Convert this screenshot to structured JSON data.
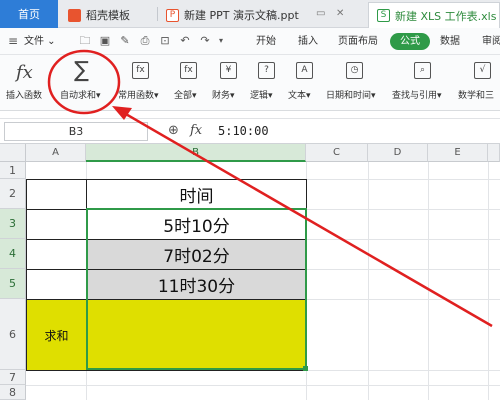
{
  "tabs": [
    {
      "label": "首页"
    },
    {
      "label": "稻壳模板"
    },
    {
      "label": "新建 PPT 演示文稿.ppt"
    },
    {
      "label": "新建 XLS 工作表.xls"
    }
  ],
  "menu": {
    "file": "文件",
    "items": [
      "开始",
      "插入",
      "页面布局",
      "公式",
      "数据",
      "审阅"
    ],
    "active": "公式"
  },
  "ribbon": [
    {
      "label": "插入函数",
      "icon": "fx-icon"
    },
    {
      "label": "自动求和",
      "icon": "sigma-icon"
    },
    {
      "label": "常用函数",
      "icon": "common-func-icon"
    },
    {
      "label": "全部",
      "icon": "all-func-icon"
    },
    {
      "label": "财务",
      "icon": "finance-icon"
    },
    {
      "label": "逻辑",
      "icon": "logic-icon"
    },
    {
      "label": "文本",
      "icon": "text-icon"
    },
    {
      "label": "日期和时间",
      "icon": "clock-icon"
    },
    {
      "label": "查找与引用",
      "icon": "lookup-icon"
    },
    {
      "label": "数学和三",
      "icon": "math-icon"
    }
  ],
  "formula_bar": {
    "cell_ref": "B3",
    "fx_label": "fx",
    "value": "5:10:00"
  },
  "sheet": {
    "columns": [
      "A",
      "B",
      "C",
      "D",
      "E"
    ],
    "rows": [
      "1",
      "2",
      "3",
      "4",
      "5",
      "6",
      "7",
      "8"
    ],
    "cells": {
      "B2": "时间",
      "B3": "5时10分",
      "B4": "7时02分",
      "B5": "11时30分",
      "A6": "求和"
    }
  },
  "colors": {
    "accent_green": "#2f9a48",
    "home_blue": "#2e7dd7",
    "sum_yellow": "#dfdf00",
    "cell_grey": "#d9d9d9",
    "annotation_red": "#e02020"
  }
}
